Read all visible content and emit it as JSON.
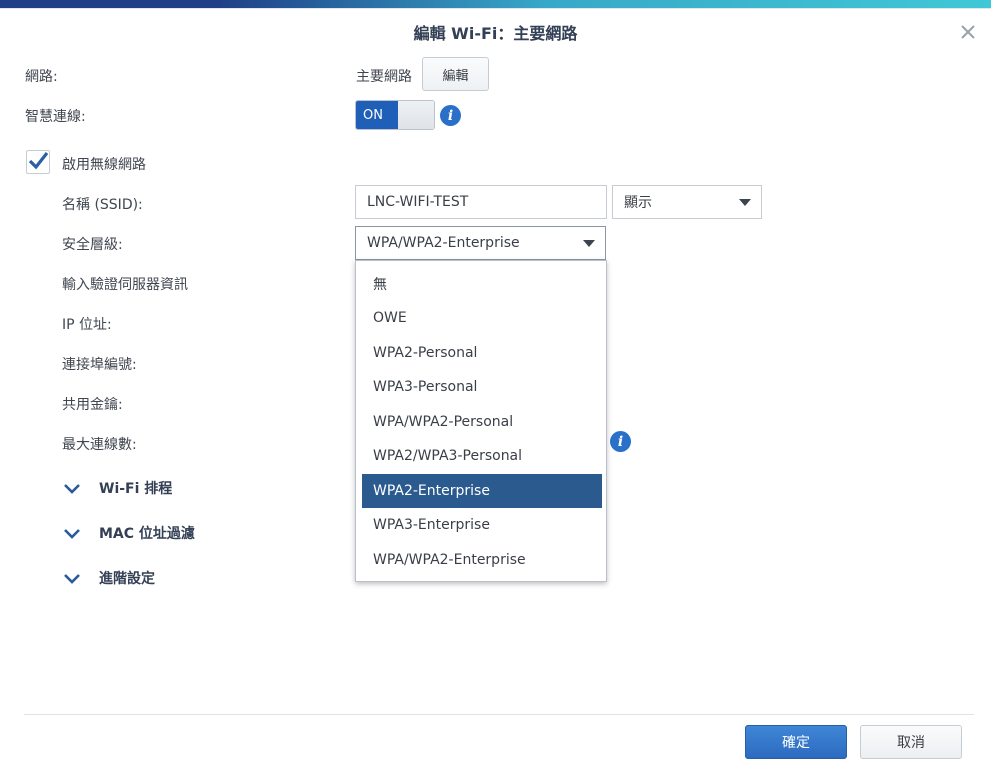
{
  "dialog": {
    "title": "編輯 Wi-Fi：主要網路"
  },
  "form": {
    "network_label": "網路:",
    "network_value": "主要網路",
    "edit_button": "編輯",
    "smart_connect_label": "智慧連線:",
    "smart_connect_state": "ON",
    "enable_wireless_label": "啟用無線網路",
    "enable_wireless_checked": true,
    "ssid_label": "名稱 (SSID):",
    "ssid_value": "LNC-WIFI-TEST",
    "ssid_visibility": "顯示",
    "security_label": "安全層級:",
    "security_value": "WPA/WPA2-Enterprise",
    "auth_server_label": "輸入驗證伺服器資訊",
    "ip_label": "IP 位址:",
    "port_label": "連接埠編號:",
    "shared_key_label": "共用金鑰:",
    "max_connections_label": "最大連線數:"
  },
  "security_dropdown": {
    "options": [
      "無",
      "OWE",
      "WPA2-Personal",
      "WPA3-Personal",
      "WPA/WPA2-Personal",
      "WPA2/WPA3-Personal",
      "WPA2-Enterprise",
      "WPA3-Enterprise",
      "WPA/WPA2-Enterprise"
    ],
    "highlighted": "WPA2-Enterprise"
  },
  "sections": {
    "wifi_schedule": "Wi-Fi 排程",
    "mac_filter": "MAC 位址過濾",
    "advanced": "進階設定"
  },
  "footer": {
    "confirm": "確定",
    "cancel": "取消"
  },
  "colors": {
    "accent": "#1f5fb8",
    "highlight": "#2b5a8f",
    "primary_button": "#2c6bc0"
  },
  "icons": {
    "close": "close-icon",
    "info": "info-icon",
    "check": "checkmark-icon",
    "chevron": "chevron-down-icon",
    "caret": "caret-down-icon"
  }
}
